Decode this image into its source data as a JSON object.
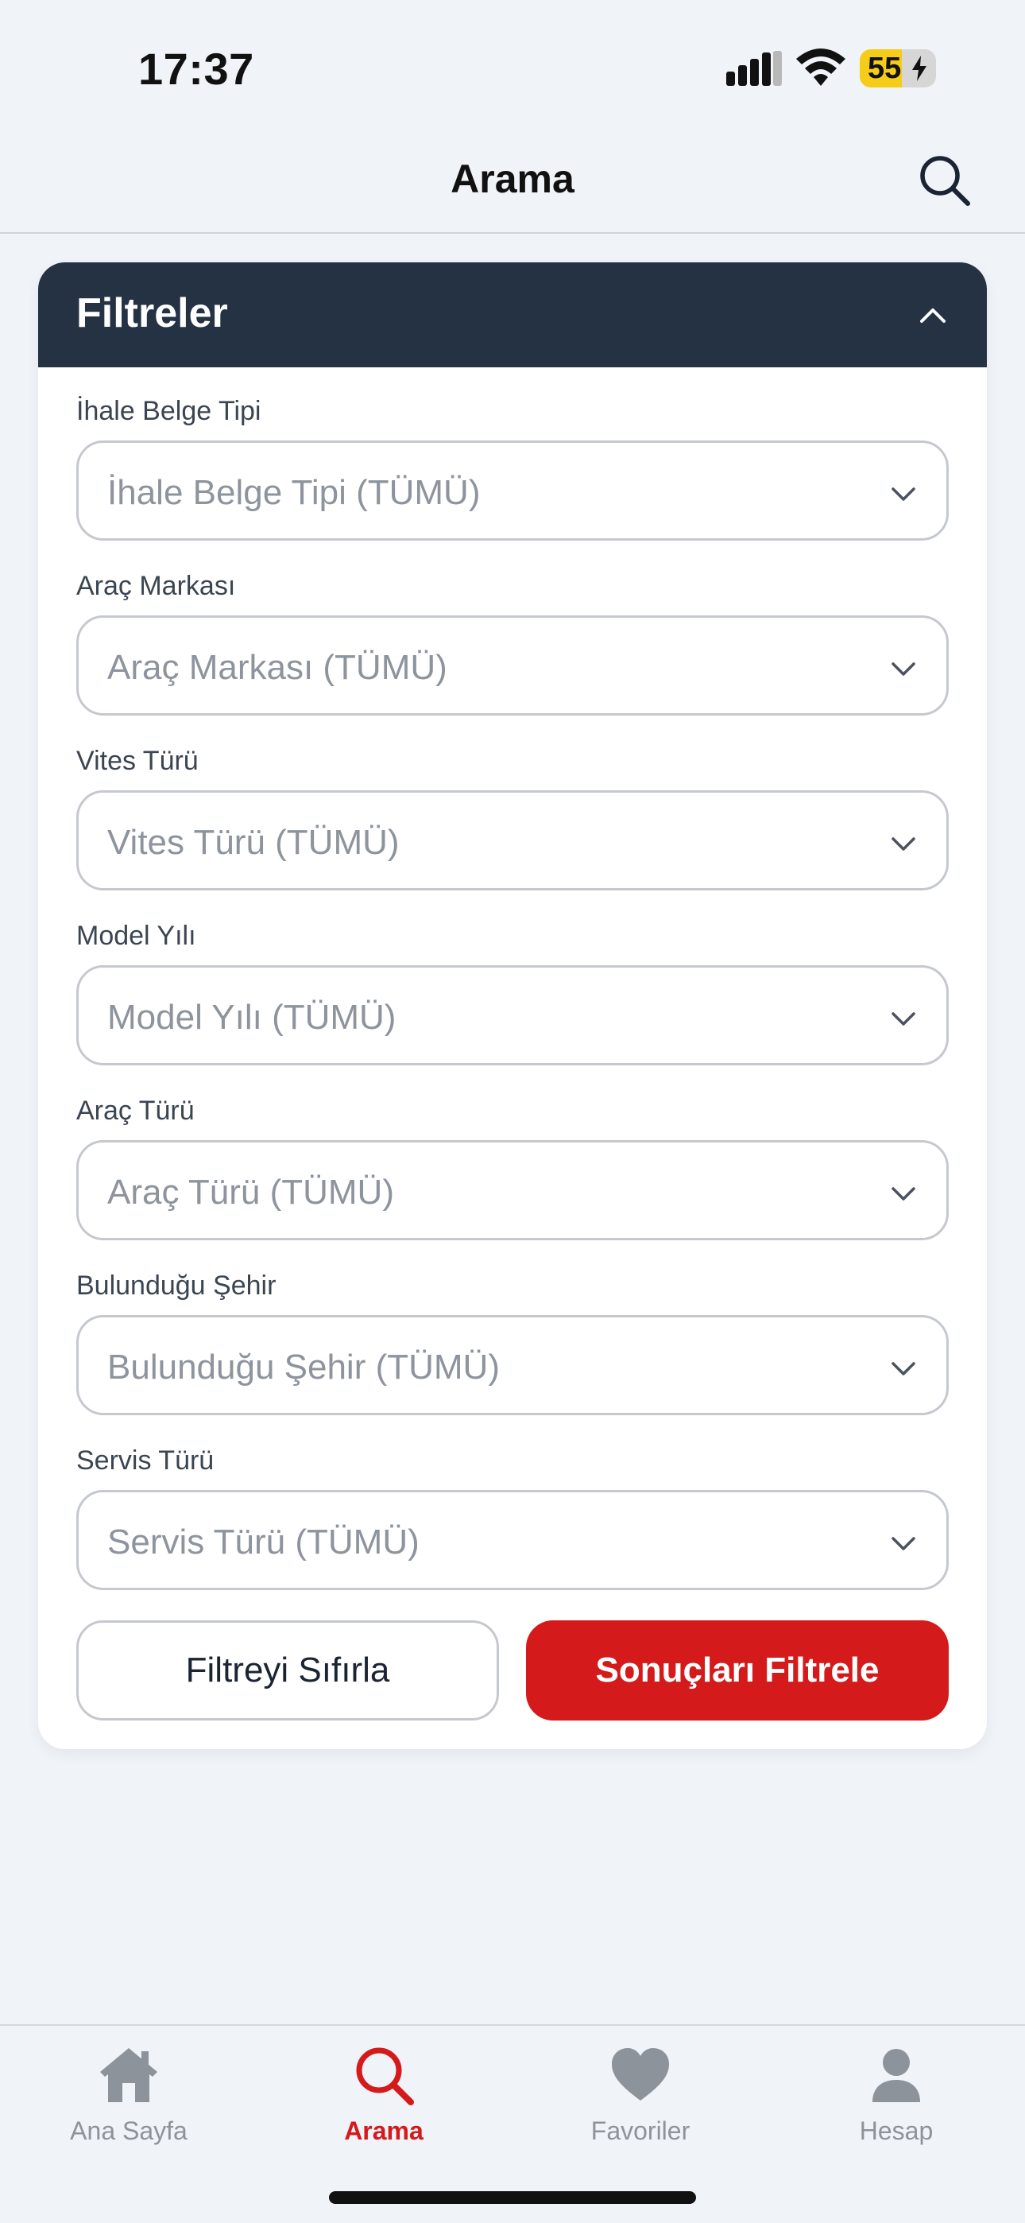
{
  "status_bar": {
    "time": "17:37",
    "battery": "55",
    "battery_level": 0.55
  },
  "nav": {
    "title": "Arama"
  },
  "filters": {
    "title": "Filtreler",
    "fields": [
      {
        "label": "İhale Belge Tipi",
        "placeholder": "İhale Belge Tipi (TÜMÜ)"
      },
      {
        "label": "Araç Markası",
        "placeholder": "Araç Markası (TÜMÜ)"
      },
      {
        "label": "Vites Türü",
        "placeholder": "Vites Türü (TÜMÜ)"
      },
      {
        "label": "Model Yılı",
        "placeholder": "Model Yılı (TÜMÜ)"
      },
      {
        "label": "Araç Türü",
        "placeholder": "Araç Türü (TÜMÜ)"
      },
      {
        "label": "Bulunduğu Şehir",
        "placeholder": "Bulunduğu Şehir (TÜMÜ)"
      },
      {
        "label": "Servis Türü",
        "placeholder": "Servis Türü (TÜMÜ)"
      }
    ],
    "reset_label": "Filtreyi Sıfırla",
    "apply_label": "Sonuçları Filtrele"
  },
  "tabs": [
    {
      "label": "Ana Sayfa",
      "icon": "home-icon",
      "active": false
    },
    {
      "label": "Arama",
      "icon": "search-icon",
      "active": true
    },
    {
      "label": "Favoriler",
      "icon": "heart-icon",
      "active": false
    },
    {
      "label": "Hesap",
      "icon": "user-icon",
      "active": false
    }
  ],
  "colors": {
    "accent": "#d41a1a",
    "header": "#253244",
    "battery": "#f5cc17"
  }
}
